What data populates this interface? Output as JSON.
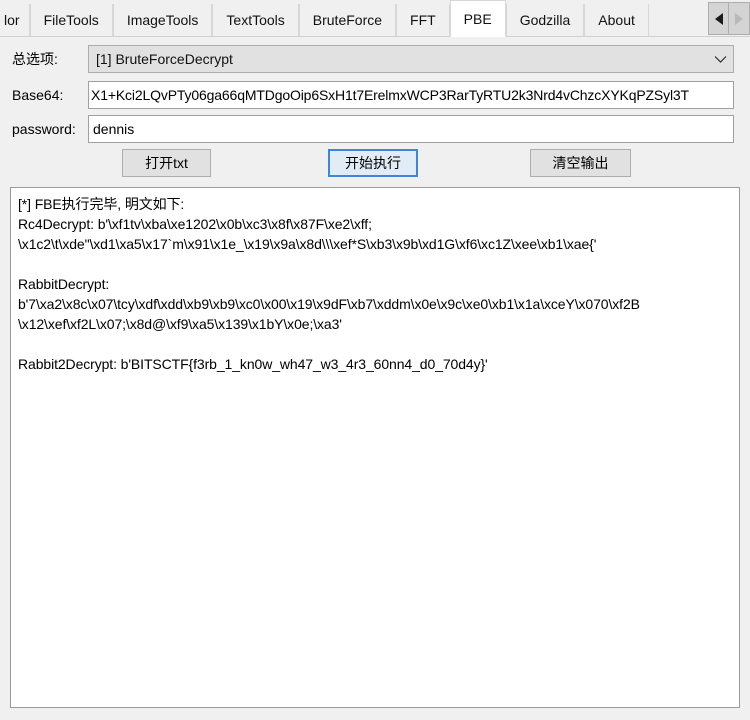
{
  "tabs": {
    "items": [
      {
        "label": "lor",
        "active": false,
        "clipped": true
      },
      {
        "label": "FileTools",
        "active": false
      },
      {
        "label": "ImageTools",
        "active": false
      },
      {
        "label": "TextTools",
        "active": false
      },
      {
        "label": "BruteForce",
        "active": false
      },
      {
        "label": "FFT",
        "active": false
      },
      {
        "label": "PBE",
        "active": true
      },
      {
        "label": "Godzilla",
        "active": false
      },
      {
        "label": "About",
        "active": false
      }
    ],
    "scroll_left_icon": "triangle-left-icon",
    "scroll_right_icon": "triangle-right-icon"
  },
  "form": {
    "option_label": "总选项:",
    "option_value": "[1] BruteForceDecrypt",
    "option_arrow_icon": "chevron-down-icon",
    "base64_label": "Base64:",
    "base64_value": "X1+Kci2LQvPTy06ga66qMTDgoOip6SxH1t7ErelmxWCP3RarTyRTU2k3Nrd4vChzcXYKqPZSyl3T",
    "base64_placeholder": "",
    "password_label": "password:",
    "password_value": "dennis",
    "password_placeholder": ""
  },
  "buttons": {
    "open_txt": "打开txt",
    "run": "开始执行",
    "clear_output": "清空输出"
  },
  "output": {
    "lines": [
      "[*] FBE执行完毕, 明文如下:",
      "Rc4Decrypt: b'\\xf1tv\\xba\\xe1202\\x0b\\xc3\\x8f\\x87F\\xe2\\xff;",
      "\\x1c2\\t\\xde\"\\xd1\\xa5\\x17`m\\x91\\x1e_\\x19\\x9a\\x8d\\\\\\xef*S\\xb3\\x9b\\xd1G\\xf6\\xc1Z\\xee\\xb1\\xae{'",
      "",
      "RabbitDecrypt:",
      "b'7\\xa2\\x8c\\x07\\tcy\\xdf\\xdd\\xb9\\xb9\\xc0\\x00\\x19\\x9dF\\xb7\\xddm\\x0e\\x9c\\xe0\\xb1\\x1a\\xceY\\x070\\xf2B",
      "\\x12\\xef\\xf2L\\x07;\\x8d@\\xf9\\xa5\\x139\\x1bY\\x0e;\\xa3'",
      "",
      "Rabbit2Decrypt: b'BITSCTF{f3rb_1_kn0w_wh47_w3_4r3_60nn4_d0_70d4y}'"
    ]
  },
  "colors": {
    "window_bg": "#f0f0f0",
    "active_tab_bg": "#ffffff",
    "default_button_border": "#3b87d8",
    "default_button_bg": "#e1ecf7",
    "input_bg": "#ffffff",
    "combo_bg": "#e1e1e1"
  }
}
